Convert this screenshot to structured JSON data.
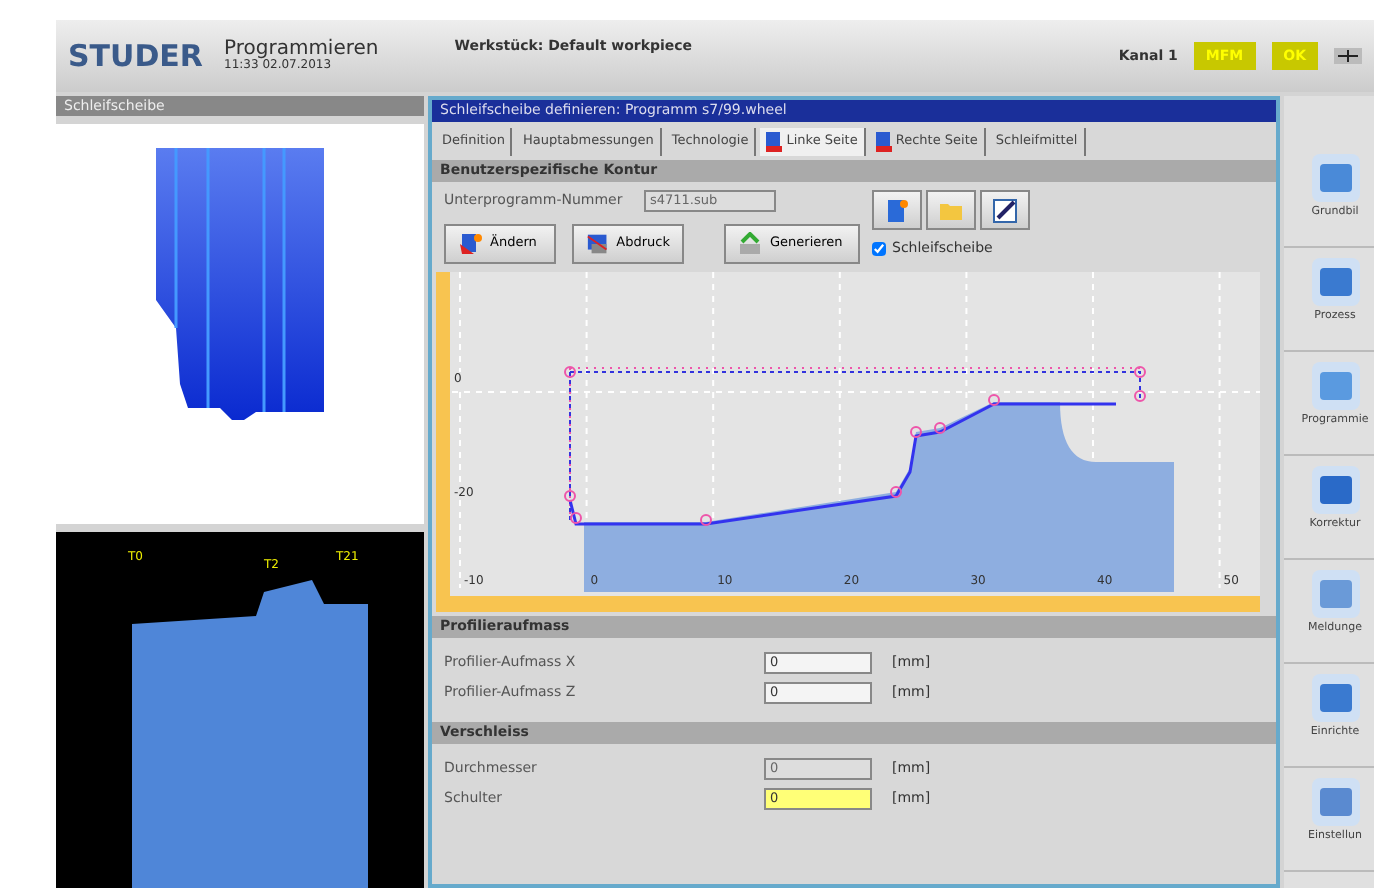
{
  "header": {
    "logo": "STUDER",
    "mode": "Programmieren",
    "datetime": "11:33 02.07.2013",
    "workpiece": "Werkstück: Default workpiece",
    "channel": "Kanal 1",
    "indicators": [
      "MFM",
      "OK"
    ]
  },
  "left_panel": {
    "title": "Schleifscheibe",
    "tool_labels": [
      "T0",
      "T2",
      "T21"
    ]
  },
  "main": {
    "title": "Schleifscheibe definieren: Programm s7/99.wheel",
    "tabs": [
      {
        "label": "Definition",
        "selected": false,
        "icon": false
      },
      {
        "label": "Hauptabmessungen",
        "selected": false,
        "icon": false
      },
      {
        "label": "Technologie",
        "selected": false,
        "icon": false
      },
      {
        "label": "Linke Seite",
        "selected": true,
        "icon": true
      },
      {
        "label": "Rechte Seite",
        "selected": false,
        "icon": true
      },
      {
        "label": "Schleifmittel",
        "selected": false,
        "icon": false
      }
    ],
    "contour_section": {
      "title": "Benutzerspezifische Kontur",
      "field_label": "Unterprogramm-Nummer",
      "field_value": "s4711.sub",
      "field_disabled": true,
      "buttons": [
        "Ändern",
        "Abdruck",
        "Generieren"
      ],
      "checkbox": {
        "label": "Schleifscheibe",
        "checked": true
      }
    },
    "plot": {
      "x_labels": [
        "-10",
        "0",
        "10",
        "20",
        "30",
        "40",
        "50"
      ],
      "y_labels": [
        "0",
        "-20"
      ]
    },
    "sections": [
      {
        "title": "Profilieraufmass",
        "fields": [
          {
            "label": "Profilier-Aufmass X",
            "value": "0",
            "unit": "[mm]",
            "disabled": false,
            "highlighted": false
          },
          {
            "label": "Profilier-Aufmass Z",
            "value": "0",
            "unit": "[mm]",
            "disabled": false,
            "highlighted": false
          }
        ]
      },
      {
        "title": "Verschleiss",
        "fields": [
          {
            "label": "Durchmesser",
            "value": "0",
            "unit": "[mm]",
            "disabled": true,
            "highlighted": false
          },
          {
            "label": "Schulter",
            "value": "0",
            "unit": "[mm]",
            "disabled": false,
            "highlighted": true
          }
        ]
      }
    ]
  },
  "sidebar": {
    "items": [
      {
        "label": "Grundbil"
      },
      {
        "label": "Prozess"
      },
      {
        "label": "Programmie"
      },
      {
        "label": "Korrektur"
      },
      {
        "label": "Meldunge"
      },
      {
        "label": "Einrichte"
      },
      {
        "label": "Einstellun"
      }
    ]
  }
}
